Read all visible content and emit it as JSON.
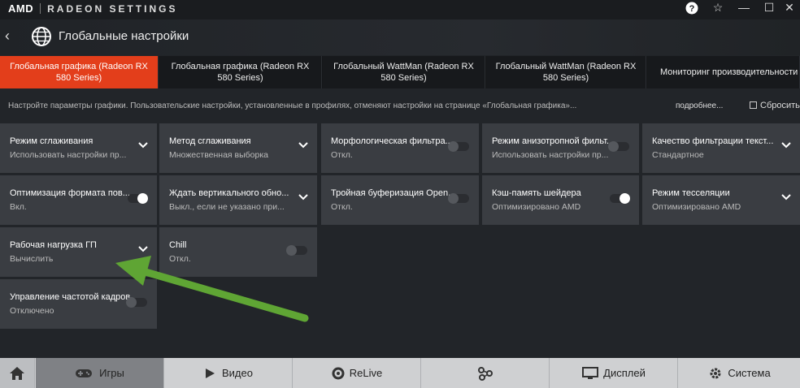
{
  "brand": {
    "logo": "AMD",
    "app_name": "RADEON SETTINGS"
  },
  "window_controls": {
    "help": "?",
    "star": "☆",
    "minimize": "—",
    "maximize": "☐",
    "close": "✕"
  },
  "header": {
    "back": "‹",
    "title": "Глобальные настройки"
  },
  "tabs": [
    "Глобальная графика (Radeon RX 580 Series)",
    "Глобальная графика (Radeon RX 580 Series)",
    "Глобальный WattMan (Radeon RX 580 Series)",
    "Глобальный WattMan (Radeon RX 580 Series)",
    "Мониторинг производительности"
  ],
  "description": "Настройте параметры графики. Пользовательские настройки, установленные в профилях, отменяют настройки на странице «Глобальная графика»...",
  "more_link": "подробнее...",
  "reset_label": "Сбросить",
  "settings": [
    {
      "title": "Режим сглаживания",
      "value": "Использовать настройки пр...",
      "control": "dropdown"
    },
    {
      "title": "Метод сглаживания",
      "value": "Множественная выборка",
      "control": "dropdown"
    },
    {
      "title": "Морфологическая фильтра...",
      "value": "Откл.",
      "control": "toggle-off"
    },
    {
      "title": "Режим анизотропной фильт...",
      "value": "Использовать настройки пр...",
      "control": "toggle-off"
    },
    {
      "title": "Качество фильтрации текст...",
      "value": "Стандартное",
      "control": "dropdown"
    },
    {
      "title": "Оптимизация формата пов...",
      "value": "Вкл.",
      "control": "toggle-on"
    },
    {
      "title": "Ждать вертикального обно...",
      "value": "Выкл., если не указано при...",
      "control": "dropdown"
    },
    {
      "title": "Тройная буферизация Open...",
      "value": "Откл.",
      "control": "toggle-off"
    },
    {
      "title": "Кэш-память шейдера",
      "value": "Оптимизировано AMD",
      "control": "toggle-on"
    },
    {
      "title": "Режим тесселяции",
      "value": "Оптимизировано AMD",
      "control": "dropdown"
    },
    {
      "title": "Рабочая нагрузка ГП",
      "value": "Вычислить",
      "control": "dropdown"
    },
    {
      "title": "Chill",
      "value": "Откл.",
      "control": "toggle-off"
    },
    {
      "title": "Управление частотой кадров",
      "value": "Отключено",
      "control": "toggle-off"
    }
  ],
  "bottom_nav": {
    "home_icon": "home-icon",
    "games": "Игры",
    "video": "Видео",
    "relive": "ReLive",
    "display": "Дисплей",
    "system": "Система"
  },
  "colors": {
    "accent": "#e33e1b",
    "annotation_arrow": "#5fa534",
    "tile_bg": "#3a3d42"
  }
}
